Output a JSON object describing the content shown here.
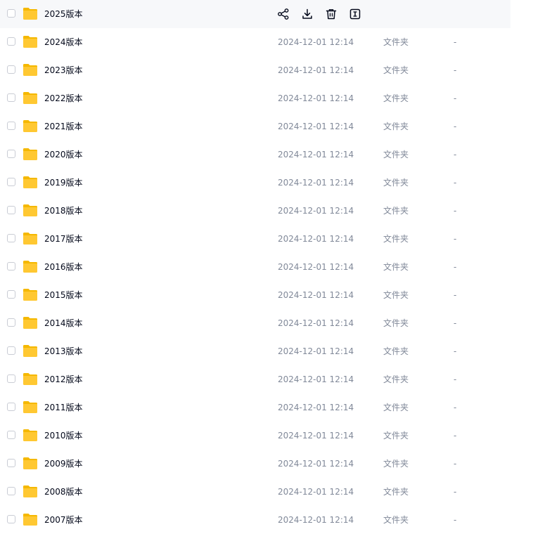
{
  "actions": {
    "share_icon": "share-icon",
    "download_icon": "download-icon",
    "delete_icon": "trash-icon",
    "more_icon": "rename-icon"
  },
  "colors": {
    "folder": "#ffc832",
    "hover_row": "#f7f8fa",
    "text_primary": "#03081a",
    "text_secondary": "#818999"
  },
  "files": [
    {
      "name": "2025版本",
      "date": "",
      "type": "",
      "size": "",
      "hovered": true
    },
    {
      "name": "2024版本",
      "date": "2024-12-01 12:14",
      "type": "文件夹",
      "size": "-"
    },
    {
      "name": "2023版本",
      "date": "2024-12-01 12:14",
      "type": "文件夹",
      "size": "-"
    },
    {
      "name": "2022版本",
      "date": "2024-12-01 12:14",
      "type": "文件夹",
      "size": "-"
    },
    {
      "name": "2021版本",
      "date": "2024-12-01 12:14",
      "type": "文件夹",
      "size": "-"
    },
    {
      "name": "2020版本",
      "date": "2024-12-01 12:14",
      "type": "文件夹",
      "size": "-"
    },
    {
      "name": "2019版本",
      "date": "2024-12-01 12:14",
      "type": "文件夹",
      "size": "-"
    },
    {
      "name": "2018版本",
      "date": "2024-12-01 12:14",
      "type": "文件夹",
      "size": "-"
    },
    {
      "name": "2017版本",
      "date": "2024-12-01 12:14",
      "type": "文件夹",
      "size": "-"
    },
    {
      "name": "2016版本",
      "date": "2024-12-01 12:14",
      "type": "文件夹",
      "size": "-"
    },
    {
      "name": "2015版本",
      "date": "2024-12-01 12:14",
      "type": "文件夹",
      "size": "-"
    },
    {
      "name": "2014版本",
      "date": "2024-12-01 12:14",
      "type": "文件夹",
      "size": "-"
    },
    {
      "name": "2013版本",
      "date": "2024-12-01 12:14",
      "type": "文件夹",
      "size": "-"
    },
    {
      "name": "2012版本",
      "date": "2024-12-01 12:14",
      "type": "文件夹",
      "size": "-"
    },
    {
      "name": "2011版本",
      "date": "2024-12-01 12:14",
      "type": "文件夹",
      "size": "-"
    },
    {
      "name": "2010版本",
      "date": "2024-12-01 12:14",
      "type": "文件夹",
      "size": "-"
    },
    {
      "name": "2009版本",
      "date": "2024-12-01 12:14",
      "type": "文件夹",
      "size": "-"
    },
    {
      "name": "2008版本",
      "date": "2024-12-01 12:14",
      "type": "文件夹",
      "size": "-"
    },
    {
      "name": "2007版本",
      "date": "2024-12-01 12:14",
      "type": "文件夹",
      "size": "-"
    }
  ]
}
